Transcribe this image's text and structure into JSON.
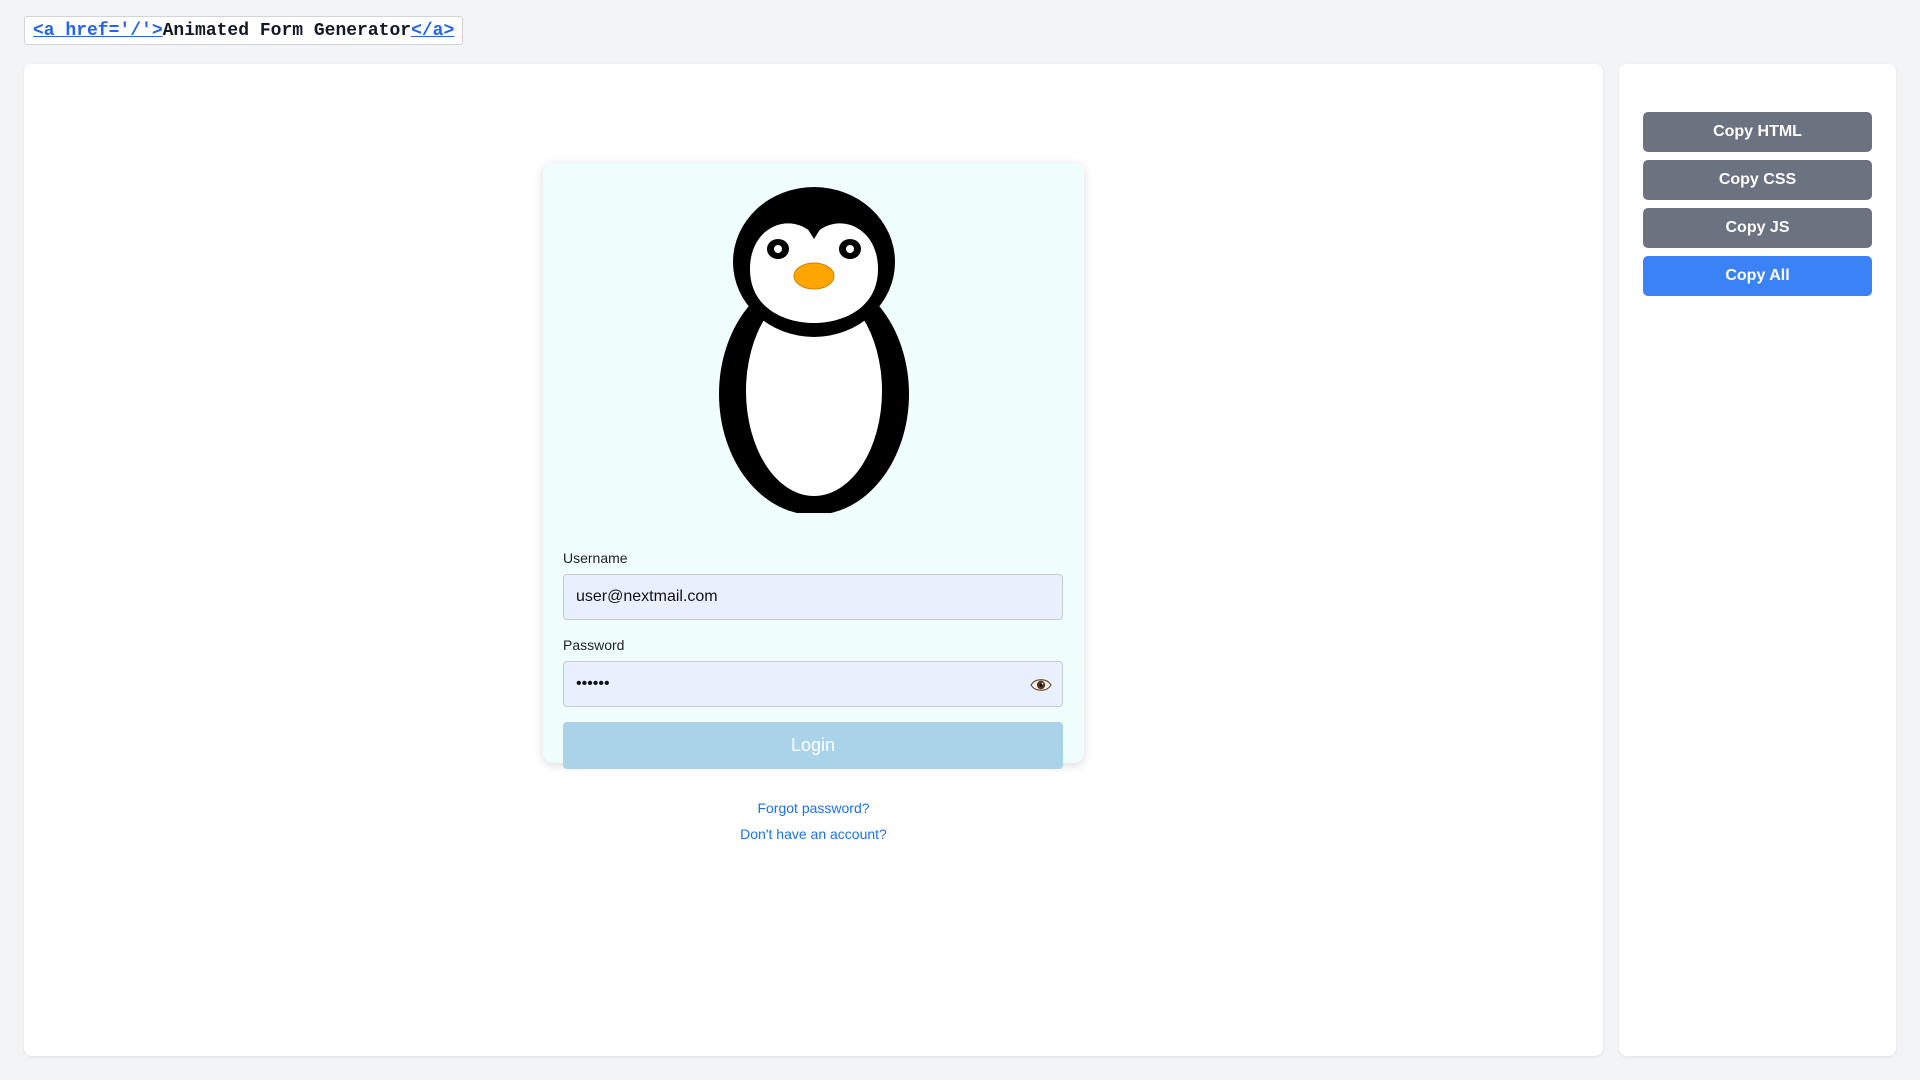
{
  "header": {
    "open_tag": "<a href='/'>",
    "title": "Animated Form Generator",
    "close_tag": "</a>"
  },
  "sidebar": {
    "buttons": [
      {
        "label": "Copy HTML",
        "color": "#6b7280"
      },
      {
        "label": "Copy CSS",
        "color": "#6b7280"
      },
      {
        "label": "Copy JS",
        "color": "#6b7280"
      },
      {
        "label": "Copy All",
        "color": "#3b82f6"
      }
    ]
  },
  "form": {
    "username_label": "Username",
    "username_value": "user@nextmail.com",
    "password_label": "Password",
    "password_value": "••••••",
    "login_label": "Login",
    "forgot_label": "Forgot password?",
    "signup_label": "Don't have an account?",
    "mascot_icon": "penguin-icon",
    "toggle_icon": "eye-icon"
  },
  "colors": {
    "page_bg": "#f3f4f6",
    "accent": "#3b82f6",
    "link": "#1a73e8",
    "card_bg": "#f0fdfd",
    "login_button": "#aad3e9",
    "beak": "#ffa500"
  }
}
